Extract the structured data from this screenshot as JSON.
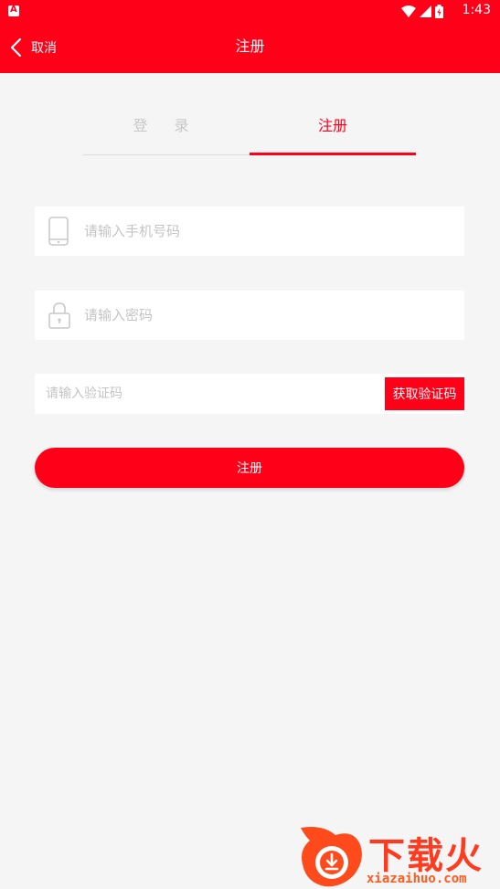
{
  "status_bar": {
    "time": "1:43",
    "notification_icon": "android-notification-icon",
    "icons": [
      "wifi-icon",
      "signal-icon",
      "battery-icon"
    ]
  },
  "nav": {
    "back_label": "取消",
    "title": "注册"
  },
  "tabs": [
    {
      "label": "登 录",
      "active": false
    },
    {
      "label": "注册",
      "active": true
    }
  ],
  "form": {
    "phone": {
      "placeholder": "请输入手机号码",
      "value": ""
    },
    "password": {
      "placeholder": "请输入密码",
      "value": ""
    },
    "code": {
      "placeholder": "请输入验证码",
      "value": "",
      "button_label": "获取验证码"
    },
    "submit_label": "注册"
  },
  "watermark": {
    "brand": "下载火",
    "url": "xiazaihuo.com"
  },
  "colors": {
    "primary": "#ff0019",
    "background": "#f5f5f5",
    "placeholder": "#c4c4c4",
    "inactive_tab": "#c7c7c7"
  }
}
